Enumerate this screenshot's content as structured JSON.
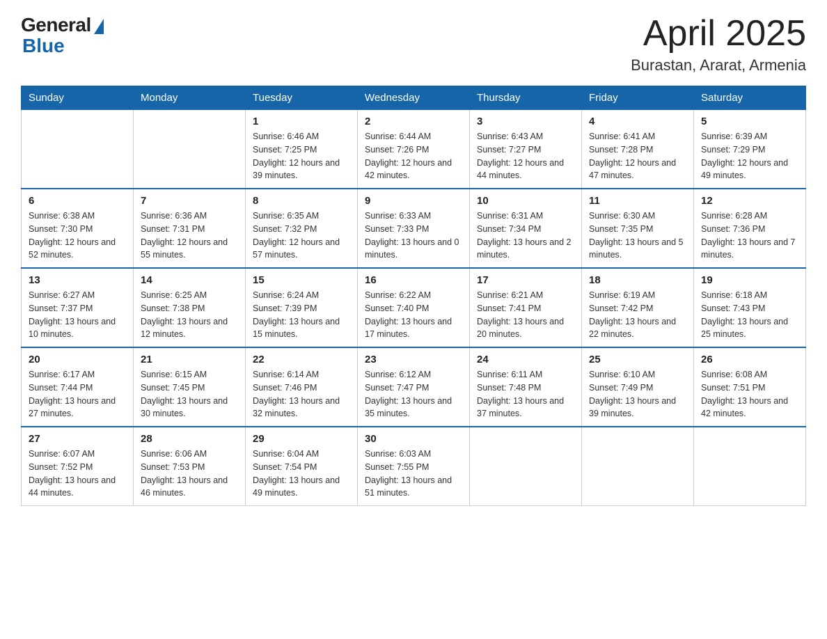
{
  "header": {
    "logo_general": "General",
    "logo_blue": "Blue",
    "month_title": "April 2025",
    "location": "Burastan, Ararat, Armenia"
  },
  "weekdays": [
    "Sunday",
    "Monday",
    "Tuesday",
    "Wednesday",
    "Thursday",
    "Friday",
    "Saturday"
  ],
  "weeks": [
    [
      {
        "day": "",
        "sunrise": "",
        "sunset": "",
        "daylight": ""
      },
      {
        "day": "",
        "sunrise": "",
        "sunset": "",
        "daylight": ""
      },
      {
        "day": "1",
        "sunrise": "Sunrise: 6:46 AM",
        "sunset": "Sunset: 7:25 PM",
        "daylight": "Daylight: 12 hours and 39 minutes."
      },
      {
        "day": "2",
        "sunrise": "Sunrise: 6:44 AM",
        "sunset": "Sunset: 7:26 PM",
        "daylight": "Daylight: 12 hours and 42 minutes."
      },
      {
        "day": "3",
        "sunrise": "Sunrise: 6:43 AM",
        "sunset": "Sunset: 7:27 PM",
        "daylight": "Daylight: 12 hours and 44 minutes."
      },
      {
        "day": "4",
        "sunrise": "Sunrise: 6:41 AM",
        "sunset": "Sunset: 7:28 PM",
        "daylight": "Daylight: 12 hours and 47 minutes."
      },
      {
        "day": "5",
        "sunrise": "Sunrise: 6:39 AM",
        "sunset": "Sunset: 7:29 PM",
        "daylight": "Daylight: 12 hours and 49 minutes."
      }
    ],
    [
      {
        "day": "6",
        "sunrise": "Sunrise: 6:38 AM",
        "sunset": "Sunset: 7:30 PM",
        "daylight": "Daylight: 12 hours and 52 minutes."
      },
      {
        "day": "7",
        "sunrise": "Sunrise: 6:36 AM",
        "sunset": "Sunset: 7:31 PM",
        "daylight": "Daylight: 12 hours and 55 minutes."
      },
      {
        "day": "8",
        "sunrise": "Sunrise: 6:35 AM",
        "sunset": "Sunset: 7:32 PM",
        "daylight": "Daylight: 12 hours and 57 minutes."
      },
      {
        "day": "9",
        "sunrise": "Sunrise: 6:33 AM",
        "sunset": "Sunset: 7:33 PM",
        "daylight": "Daylight: 13 hours and 0 minutes."
      },
      {
        "day": "10",
        "sunrise": "Sunrise: 6:31 AM",
        "sunset": "Sunset: 7:34 PM",
        "daylight": "Daylight: 13 hours and 2 minutes."
      },
      {
        "day": "11",
        "sunrise": "Sunrise: 6:30 AM",
        "sunset": "Sunset: 7:35 PM",
        "daylight": "Daylight: 13 hours and 5 minutes."
      },
      {
        "day": "12",
        "sunrise": "Sunrise: 6:28 AM",
        "sunset": "Sunset: 7:36 PM",
        "daylight": "Daylight: 13 hours and 7 minutes."
      }
    ],
    [
      {
        "day": "13",
        "sunrise": "Sunrise: 6:27 AM",
        "sunset": "Sunset: 7:37 PM",
        "daylight": "Daylight: 13 hours and 10 minutes."
      },
      {
        "day": "14",
        "sunrise": "Sunrise: 6:25 AM",
        "sunset": "Sunset: 7:38 PM",
        "daylight": "Daylight: 13 hours and 12 minutes."
      },
      {
        "day": "15",
        "sunrise": "Sunrise: 6:24 AM",
        "sunset": "Sunset: 7:39 PM",
        "daylight": "Daylight: 13 hours and 15 minutes."
      },
      {
        "day": "16",
        "sunrise": "Sunrise: 6:22 AM",
        "sunset": "Sunset: 7:40 PM",
        "daylight": "Daylight: 13 hours and 17 minutes."
      },
      {
        "day": "17",
        "sunrise": "Sunrise: 6:21 AM",
        "sunset": "Sunset: 7:41 PM",
        "daylight": "Daylight: 13 hours and 20 minutes."
      },
      {
        "day": "18",
        "sunrise": "Sunrise: 6:19 AM",
        "sunset": "Sunset: 7:42 PM",
        "daylight": "Daylight: 13 hours and 22 minutes."
      },
      {
        "day": "19",
        "sunrise": "Sunrise: 6:18 AM",
        "sunset": "Sunset: 7:43 PM",
        "daylight": "Daylight: 13 hours and 25 minutes."
      }
    ],
    [
      {
        "day": "20",
        "sunrise": "Sunrise: 6:17 AM",
        "sunset": "Sunset: 7:44 PM",
        "daylight": "Daylight: 13 hours and 27 minutes."
      },
      {
        "day": "21",
        "sunrise": "Sunrise: 6:15 AM",
        "sunset": "Sunset: 7:45 PM",
        "daylight": "Daylight: 13 hours and 30 minutes."
      },
      {
        "day": "22",
        "sunrise": "Sunrise: 6:14 AM",
        "sunset": "Sunset: 7:46 PM",
        "daylight": "Daylight: 13 hours and 32 minutes."
      },
      {
        "day": "23",
        "sunrise": "Sunrise: 6:12 AM",
        "sunset": "Sunset: 7:47 PM",
        "daylight": "Daylight: 13 hours and 35 minutes."
      },
      {
        "day": "24",
        "sunrise": "Sunrise: 6:11 AM",
        "sunset": "Sunset: 7:48 PM",
        "daylight": "Daylight: 13 hours and 37 minutes."
      },
      {
        "day": "25",
        "sunrise": "Sunrise: 6:10 AM",
        "sunset": "Sunset: 7:49 PM",
        "daylight": "Daylight: 13 hours and 39 minutes."
      },
      {
        "day": "26",
        "sunrise": "Sunrise: 6:08 AM",
        "sunset": "Sunset: 7:51 PM",
        "daylight": "Daylight: 13 hours and 42 minutes."
      }
    ],
    [
      {
        "day": "27",
        "sunrise": "Sunrise: 6:07 AM",
        "sunset": "Sunset: 7:52 PM",
        "daylight": "Daylight: 13 hours and 44 minutes."
      },
      {
        "day": "28",
        "sunrise": "Sunrise: 6:06 AM",
        "sunset": "Sunset: 7:53 PM",
        "daylight": "Daylight: 13 hours and 46 minutes."
      },
      {
        "day": "29",
        "sunrise": "Sunrise: 6:04 AM",
        "sunset": "Sunset: 7:54 PM",
        "daylight": "Daylight: 13 hours and 49 minutes."
      },
      {
        "day": "30",
        "sunrise": "Sunrise: 6:03 AM",
        "sunset": "Sunset: 7:55 PM",
        "daylight": "Daylight: 13 hours and 51 minutes."
      },
      {
        "day": "",
        "sunrise": "",
        "sunset": "",
        "daylight": ""
      },
      {
        "day": "",
        "sunrise": "",
        "sunset": "",
        "daylight": ""
      },
      {
        "day": "",
        "sunrise": "",
        "sunset": "",
        "daylight": ""
      }
    ]
  ]
}
